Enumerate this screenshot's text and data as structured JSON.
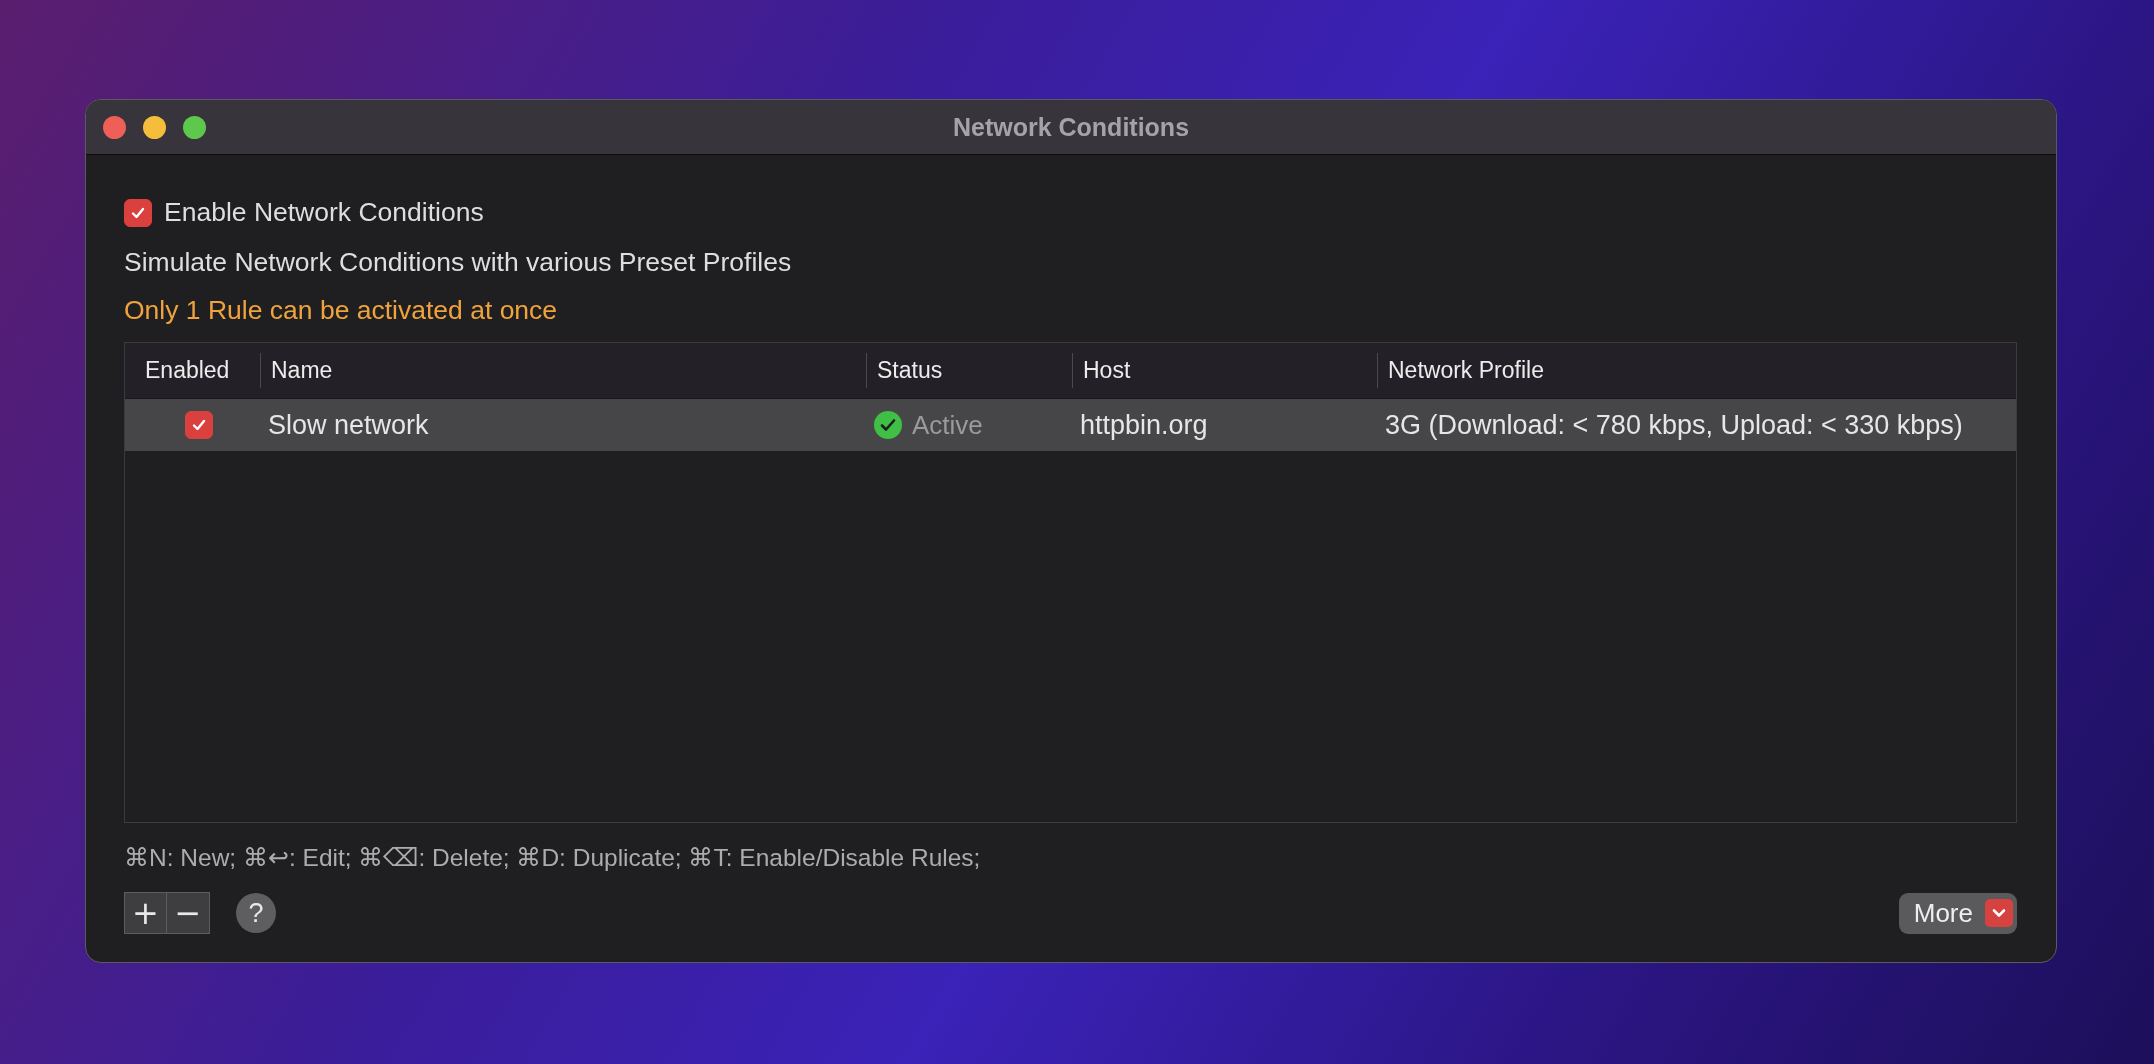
{
  "window": {
    "title": "Network Conditions"
  },
  "enable_toggle": {
    "label": "Enable Network Conditions",
    "checked": true
  },
  "description": "Simulate Network Conditions with various Preset Profiles",
  "warning": "Only 1 Rule can be activated at once",
  "table": {
    "columns": [
      "Enabled",
      "Name",
      "Status",
      "Host",
      "Network Profile"
    ],
    "rows": [
      {
        "enabled": true,
        "name": "Slow network",
        "status": "Active",
        "active": true,
        "host": "httpbin.org",
        "profile": "3G (Download: < 780 kbps, Upload: < 330 kbps)",
        "selected": true
      }
    ]
  },
  "shortcuts": "⌘N: New; ⌘↩: Edit; ⌘⌫: Delete; ⌘D: Duplicate; ⌘T: Enable/Disable Rules;",
  "buttons": {
    "add": "+",
    "remove": "−",
    "help": "?",
    "more": "More"
  }
}
